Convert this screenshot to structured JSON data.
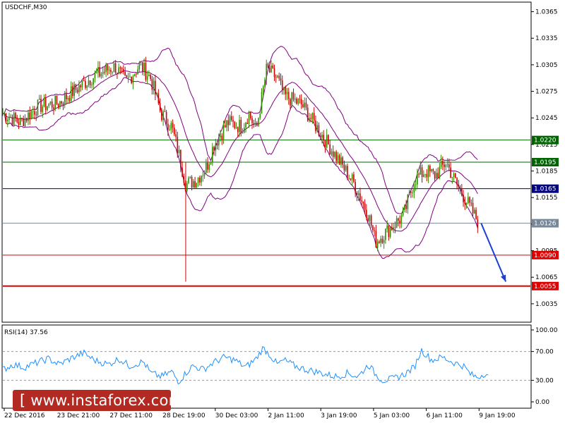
{
  "chart_data": {
    "type": "candlestick",
    "title": "USDCHF,M30",
    "price_axis": {
      "ticks": [
        "1.0365",
        "1.0335",
        "1.0305",
        "1.0275",
        "1.0245",
        "1.0215",
        "1.0185",
        "1.0155",
        "1.0125",
        "1.0095",
        "1.0065",
        "1.0035"
      ],
      "ylim": [
        1.0015,
        1.0375
      ]
    },
    "time_axis": {
      "labels": [
        "22 Dec 2016",
        "23 Dec 21:00",
        "27 Dec 11:00",
        "28 Dec 19:00",
        "30 Dec 03:00",
        "2 Jan 11:00",
        "3 Jan 19:00",
        "5 Jan 03:00",
        "6 Jan 11:00",
        "9 Jan 19:00"
      ]
    },
    "levels": [
      {
        "value": 1.022,
        "label": "1.0220",
        "color": "#006400"
      },
      {
        "value": 1.0195,
        "label": "1.0195",
        "color": "#006400"
      },
      {
        "value": 1.0165,
        "label": "1.0165",
        "color": "#000080"
      },
      {
        "value": 1.0126,
        "label": "1.0126",
        "color": "#778899"
      },
      {
        "value": 1.009,
        "label": "1.0090",
        "color": "#dd0000"
      },
      {
        "value": 1.0055,
        "label": "1.0055",
        "color": "#dd0000"
      }
    ],
    "price_path": [
      [
        0,
        1.025
      ],
      [
        0.5,
        1.024
      ],
      [
        1,
        1.0258
      ],
      [
        1.6,
        1.0262
      ],
      [
        2,
        1.0275
      ],
      [
        2.5,
        1.029
      ],
      [
        3,
        1.03
      ],
      [
        3.2,
        1.0303
      ],
      [
        3.5,
        1.0285
      ],
      [
        3.9,
        1.0305
      ],
      [
        4.2,
        1.029
      ],
      [
        4.5,
        1.025
      ],
      [
        4.8,
        1.0235
      ],
      [
        5,
        1.0205
      ],
      [
        5.2,
        1.017
      ],
      [
        5.5,
        1.0175
      ],
      [
        5.8,
        1.019
      ],
      [
        6,
        1.0215
      ],
      [
        6.4,
        1.024
      ],
      [
        6.8,
        1.0235
      ],
      [
        7.0,
        1.025
      ],
      [
        7.2,
        1.023
      ],
      [
        7.5,
        1.03
      ],
      [
        7.8,
        1.029
      ],
      [
        8,
        1.027
      ],
      [
        8.5,
        1.026
      ],
      [
        9,
        1.023
      ],
      [
        9.5,
        1.02
      ],
      [
        10,
        1.017
      ],
      [
        10.4,
        1.0135
      ],
      [
        10.6,
        1.0105
      ],
      [
        11,
        1.012
      ],
      [
        11.4,
        1.0135
      ],
      [
        11.7,
        1.0175
      ],
      [
        12,
        1.0185
      ],
      [
        12.3,
        1.018
      ],
      [
        12.6,
        1.0195
      ],
      [
        12.9,
        1.017
      ],
      [
        13.2,
        1.015
      ],
      [
        13.5,
        1.0128
      ]
    ],
    "bollinger": {
      "period": 20,
      "deviation": 2
    },
    "forecast_arrow": {
      "from": [
        13.6,
        1.0126
      ],
      "to": [
        14.3,
        1.006
      ],
      "color": "#1a3fd6"
    },
    "rsi": {
      "label": "RSI(14) 37.56",
      "value": 37.56,
      "ticks": [
        "100.00",
        "70.00",
        "30.00",
        "0.00"
      ],
      "levels": [
        70,
        30
      ],
      "path": [
        [
          0,
          45
        ],
        [
          0.3,
          52
        ],
        [
          0.6,
          48
        ],
        [
          1,
          55
        ],
        [
          1.3,
          60
        ],
        [
          1.6,
          52
        ],
        [
          2,
          62
        ],
        [
          2.3,
          68
        ],
        [
          2.6,
          58
        ],
        [
          3,
          52
        ],
        [
          3.3,
          60
        ],
        [
          3.6,
          50
        ],
        [
          4,
          56
        ],
        [
          4.2,
          40
        ],
        [
          4.5,
          35
        ],
        [
          4.8,
          42
        ],
        [
          5,
          28
        ],
        [
          5.2,
          40
        ],
        [
          5.4,
          50
        ],
        [
          5.7,
          45
        ],
        [
          6,
          55
        ],
        [
          6.3,
          62
        ],
        [
          6.6,
          58
        ],
        [
          6.9,
          48
        ],
        [
          7.2,
          60
        ],
        [
          7.4,
          75
        ],
        [
          7.6,
          65
        ],
        [
          7.8,
          52
        ],
        [
          8,
          58
        ],
        [
          8.3,
          50
        ],
        [
          8.6,
          45
        ],
        [
          8.9,
          42
        ],
        [
          9.2,
          38
        ],
        [
          9.5,
          35
        ],
        [
          9.8,
          40
        ],
        [
          10.1,
          35
        ],
        [
          10.4,
          52
        ],
        [
          10.6,
          38
        ],
        [
          10.8,
          30
        ],
        [
          11.1,
          32
        ],
        [
          11.4,
          38
        ],
        [
          11.7,
          48
        ],
        [
          11.9,
          72
        ],
        [
          12.2,
          58
        ],
        [
          12.5,
          62
        ],
        [
          12.8,
          55
        ],
        [
          13.1,
          50
        ],
        [
          13.3,
          38
        ],
        [
          13.5,
          34
        ],
        [
          13.7,
          40
        ],
        [
          13.8,
          37.56
        ]
      ]
    }
  },
  "watermark": {
    "text": "[ www.instaforex.com ]"
  }
}
